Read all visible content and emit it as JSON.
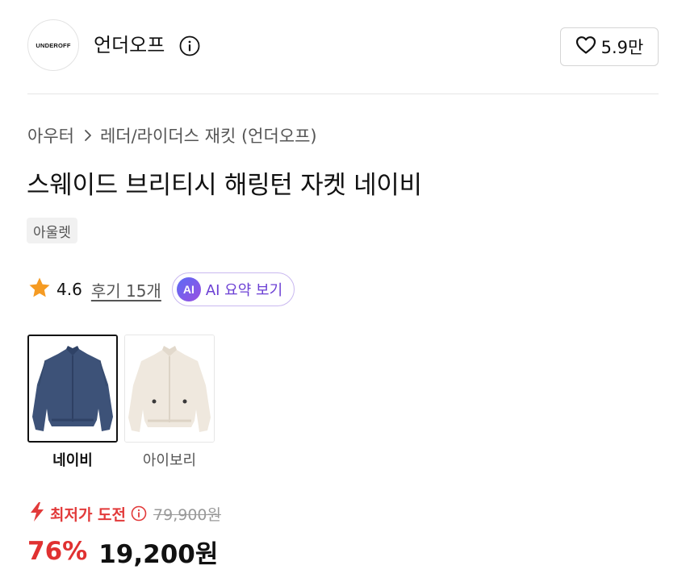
{
  "brand": {
    "logo_text": "UNDEROFF",
    "name": "언더오프"
  },
  "like": {
    "count": "5.9만"
  },
  "breadcrumb": {
    "items": [
      "아우터",
      "레더/라이더스 재킷 (언더오프)"
    ]
  },
  "product": {
    "title": "스웨이드 브리티시 해링턴 자켓 네이비",
    "tag": "아울렛"
  },
  "rating": {
    "score": "4.6",
    "review_label": "후기 15개",
    "stars": 4.6
  },
  "ai_summary": {
    "badge": "AI",
    "label": "AI 요약 보기"
  },
  "color_options": [
    {
      "label": "네이비",
      "selected": true
    },
    {
      "label": "아이보리",
      "selected": false
    }
  ],
  "price": {
    "promo_label": "최저가 도전",
    "original": "79,900원",
    "discount": "76%",
    "final": "19,200원"
  },
  "colors": {
    "accent_red": "#e03131",
    "ai_purple": "#6b3fd4",
    "star": "#f59b23"
  },
  "icons": [
    "info-icon",
    "heart-icon",
    "chevron-right-icon",
    "star-icon",
    "lightning-icon"
  ]
}
